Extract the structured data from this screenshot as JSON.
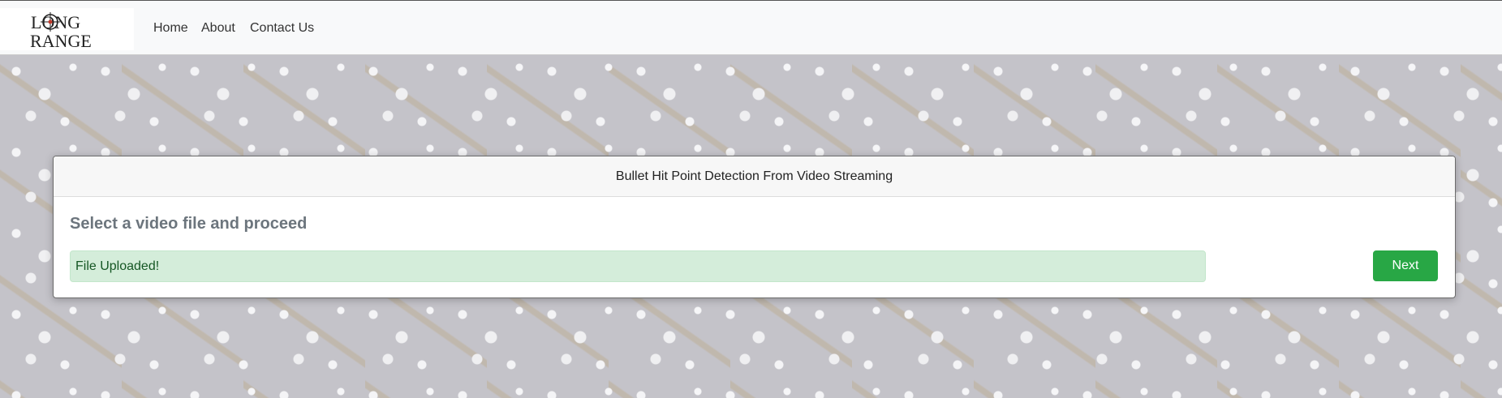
{
  "navbar": {
    "logo": {
      "line1": "LONG",
      "line2": "RANGE"
    },
    "links": [
      "Home",
      "About",
      "Contact Us"
    ]
  },
  "card": {
    "header": "Bullet Hit Point Detection From Video Streaming",
    "title": "Select a video file and proceed",
    "alert": "File Uploaded!",
    "next_label": "Next"
  },
  "colors": {
    "success": "#28a745",
    "alert_bg": "#d4edda",
    "alert_text": "#155724"
  }
}
